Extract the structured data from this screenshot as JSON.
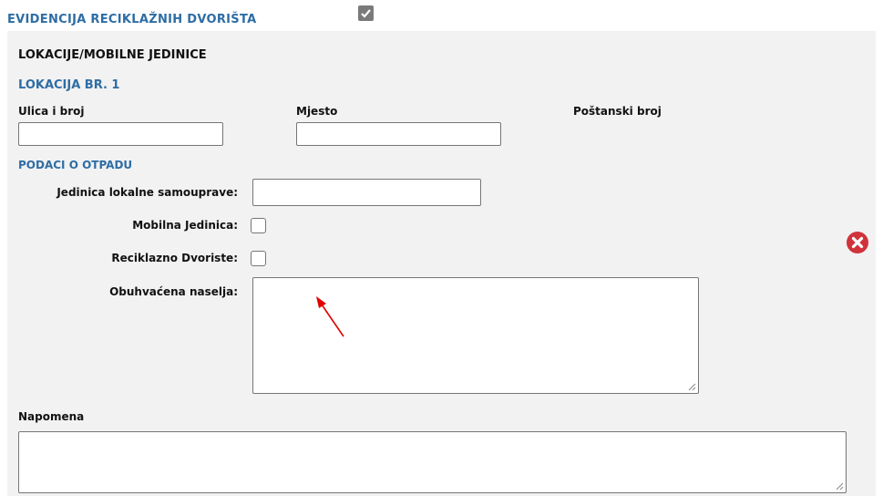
{
  "header": {
    "title": "EVIDENCIJA RECIKLAŽNIH DVORIŠTA",
    "enabled": true
  },
  "section": {
    "title": "LOKACIJE/MOBILNE JEDINICE",
    "location_title": "LOKACIJA BR. 1"
  },
  "address": {
    "street_label": "Ulica i broj",
    "street_value": "",
    "place_label": "Mjesto",
    "place_value": "",
    "postal_label": "Poštanski broj"
  },
  "waste": {
    "title": "PODACI O OTPADU",
    "local_gov_label": "Jedinica lokalne samouprave:",
    "local_gov_value": "",
    "mobile_unit_label": "Mobilna Jedinica:",
    "mobile_unit_checked": false,
    "recycling_yard_label": "Reciklazno Dvoriste:",
    "recycling_yard_checked": false,
    "settlements_label": "Obuhvaćena naselja:",
    "settlements_value": ""
  },
  "note": {
    "label": "Napomena",
    "value": ""
  },
  "colors": {
    "accent": "#2e6da4",
    "remove": "#d0333b",
    "annotation_arrow": "#e00000",
    "panel_bg": "#f2f2f2"
  }
}
